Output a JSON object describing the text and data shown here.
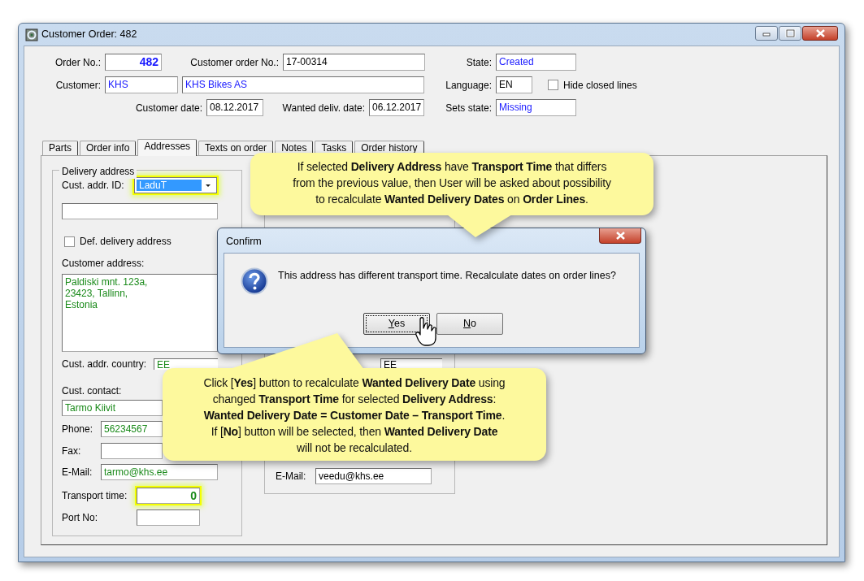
{
  "window": {
    "title": "Customer Order: 482"
  },
  "header": [
    [
      {
        "kind": "label",
        "text": "Order No.:"
      },
      {
        "kind": "number",
        "value": "482",
        "color": "#1a1aff"
      },
      {
        "kind": "label",
        "text": "Customer order No.:"
      },
      {
        "kind": "field",
        "value": "17-00314",
        "color": "#000000"
      },
      {
        "kind": "label",
        "text": "State:"
      },
      {
        "kind": "field",
        "value": "Created",
        "color": "#1a1aff"
      }
    ],
    [
      {
        "kind": "label",
        "text": "Customer:"
      },
      {
        "kind": "field",
        "value": "KHS",
        "color": "#1a1aff"
      },
      {
        "kind": "field",
        "value": "KHS Bikes AS",
        "color": "#1a1aff"
      },
      {
        "kind": "label",
        "text": "Language:"
      },
      {
        "kind": "field",
        "value": "EN",
        "color": "#000000"
      },
      {
        "kind": "checkbox",
        "label": "Hide closed lines",
        "checked": false
      }
    ],
    [
      {
        "kind": "label",
        "text": "Customer date:"
      },
      {
        "kind": "field",
        "value": "08.12.2017",
        "color": "#000000"
      },
      {
        "kind": "label",
        "text": "Wanted deliv. date:"
      },
      {
        "kind": "field",
        "value": "06.12.2017",
        "color": "#000000"
      },
      {
        "kind": "label",
        "text": "Sets state:"
      },
      {
        "kind": "field",
        "value": "Missing",
        "color": "#1a1aff"
      }
    ]
  ],
  "tabs": [
    {
      "label": "Parts",
      "selected": false
    },
    {
      "label": "Order info",
      "selected": false
    },
    {
      "label": "Addresses",
      "selected": true
    },
    {
      "label": "Texts on order",
      "selected": false
    },
    {
      "label": "Notes",
      "selected": false
    },
    {
      "label": "Tasks",
      "selected": false
    },
    {
      "label": "Order history",
      "selected": false
    }
  ],
  "delivery_address": {
    "title": "Delivery address",
    "rows": [
      {
        "kind": "combo",
        "label": "Cust. addr. ID:",
        "value": "LaduT",
        "highlighted": true
      },
      {
        "kind": "field",
        "highlighted": false
      },
      {
        "kind": "checkbox",
        "label": "Def. delivery address",
        "checked": false
      },
      {
        "kind": "caption",
        "text": "Customer address:"
      },
      {
        "kind": "textarea",
        "lines": [
          "Paldiski mnt. 123a,",
          "23423, Tallinn,",
          "Estonia"
        ],
        "color": "#1a8a1a"
      },
      {
        "kind": "field",
        "label": "Cust. addr. country:",
        "value": "EE",
        "color": "#1a8a1a",
        "highlighted": false
      },
      {
        "kind": "caption",
        "text": "Cust. contact:"
      },
      {
        "kind": "field",
        "value": "Tarmo Kiivit",
        "color": "#1a8a1a",
        "highlighted": false
      },
      {
        "kind": "field",
        "label": "Phone:",
        "value": "56234567",
        "color": "#1a8a1a",
        "highlighted": false
      },
      {
        "kind": "field",
        "label": "Fax:",
        "highlighted": false
      },
      {
        "kind": "field",
        "label": "E-Mail:",
        "value": "tarmo@khs.ee",
        "color": "#1a8a1a",
        "highlighted": false
      },
      {
        "kind": "number",
        "label": "Transport time:",
        "value": "0",
        "color": "#1a8a1a",
        "highlighted": true
      },
      {
        "kind": "field",
        "label": "Port No:",
        "highlighted": false
      }
    ]
  },
  "other_address": {
    "rows": [
      {
        "kind": "field",
        "value": "EE",
        "color": "#000000"
      },
      {
        "kind": "field",
        "label": "E-Mail:",
        "value": "veedu@khs.ee",
        "color": "#000000"
      }
    ]
  },
  "dialog": {
    "title": "Confirm",
    "message": "This address has different transport time. Recalculate dates on order lines?",
    "buttons": [
      {
        "label": "Yes",
        "focused": true
      },
      {
        "label": "No",
        "focused": false
      }
    ]
  },
  "callouts": [
    {
      "lines": [
        "If selected **Delivery Address** have **Transport Time** that differs",
        "from the previous value, then User will be asked about possibility",
        "to recalculate **Wanted Delivery Dates** on **Order Lines**."
      ]
    },
    {
      "lines": [
        "Click [**Yes**] button to recalculate **Wanted Delivery Date** using",
        "changed **Transport Time** for selected **Delivery Address**:",
        "**Wanted Delivery Date = Customer Date – Transport Time**.",
        "If [**No**] button will be selected, then **Wanted Delivery Date**",
        "will not be recalculated."
      ]
    }
  ]
}
